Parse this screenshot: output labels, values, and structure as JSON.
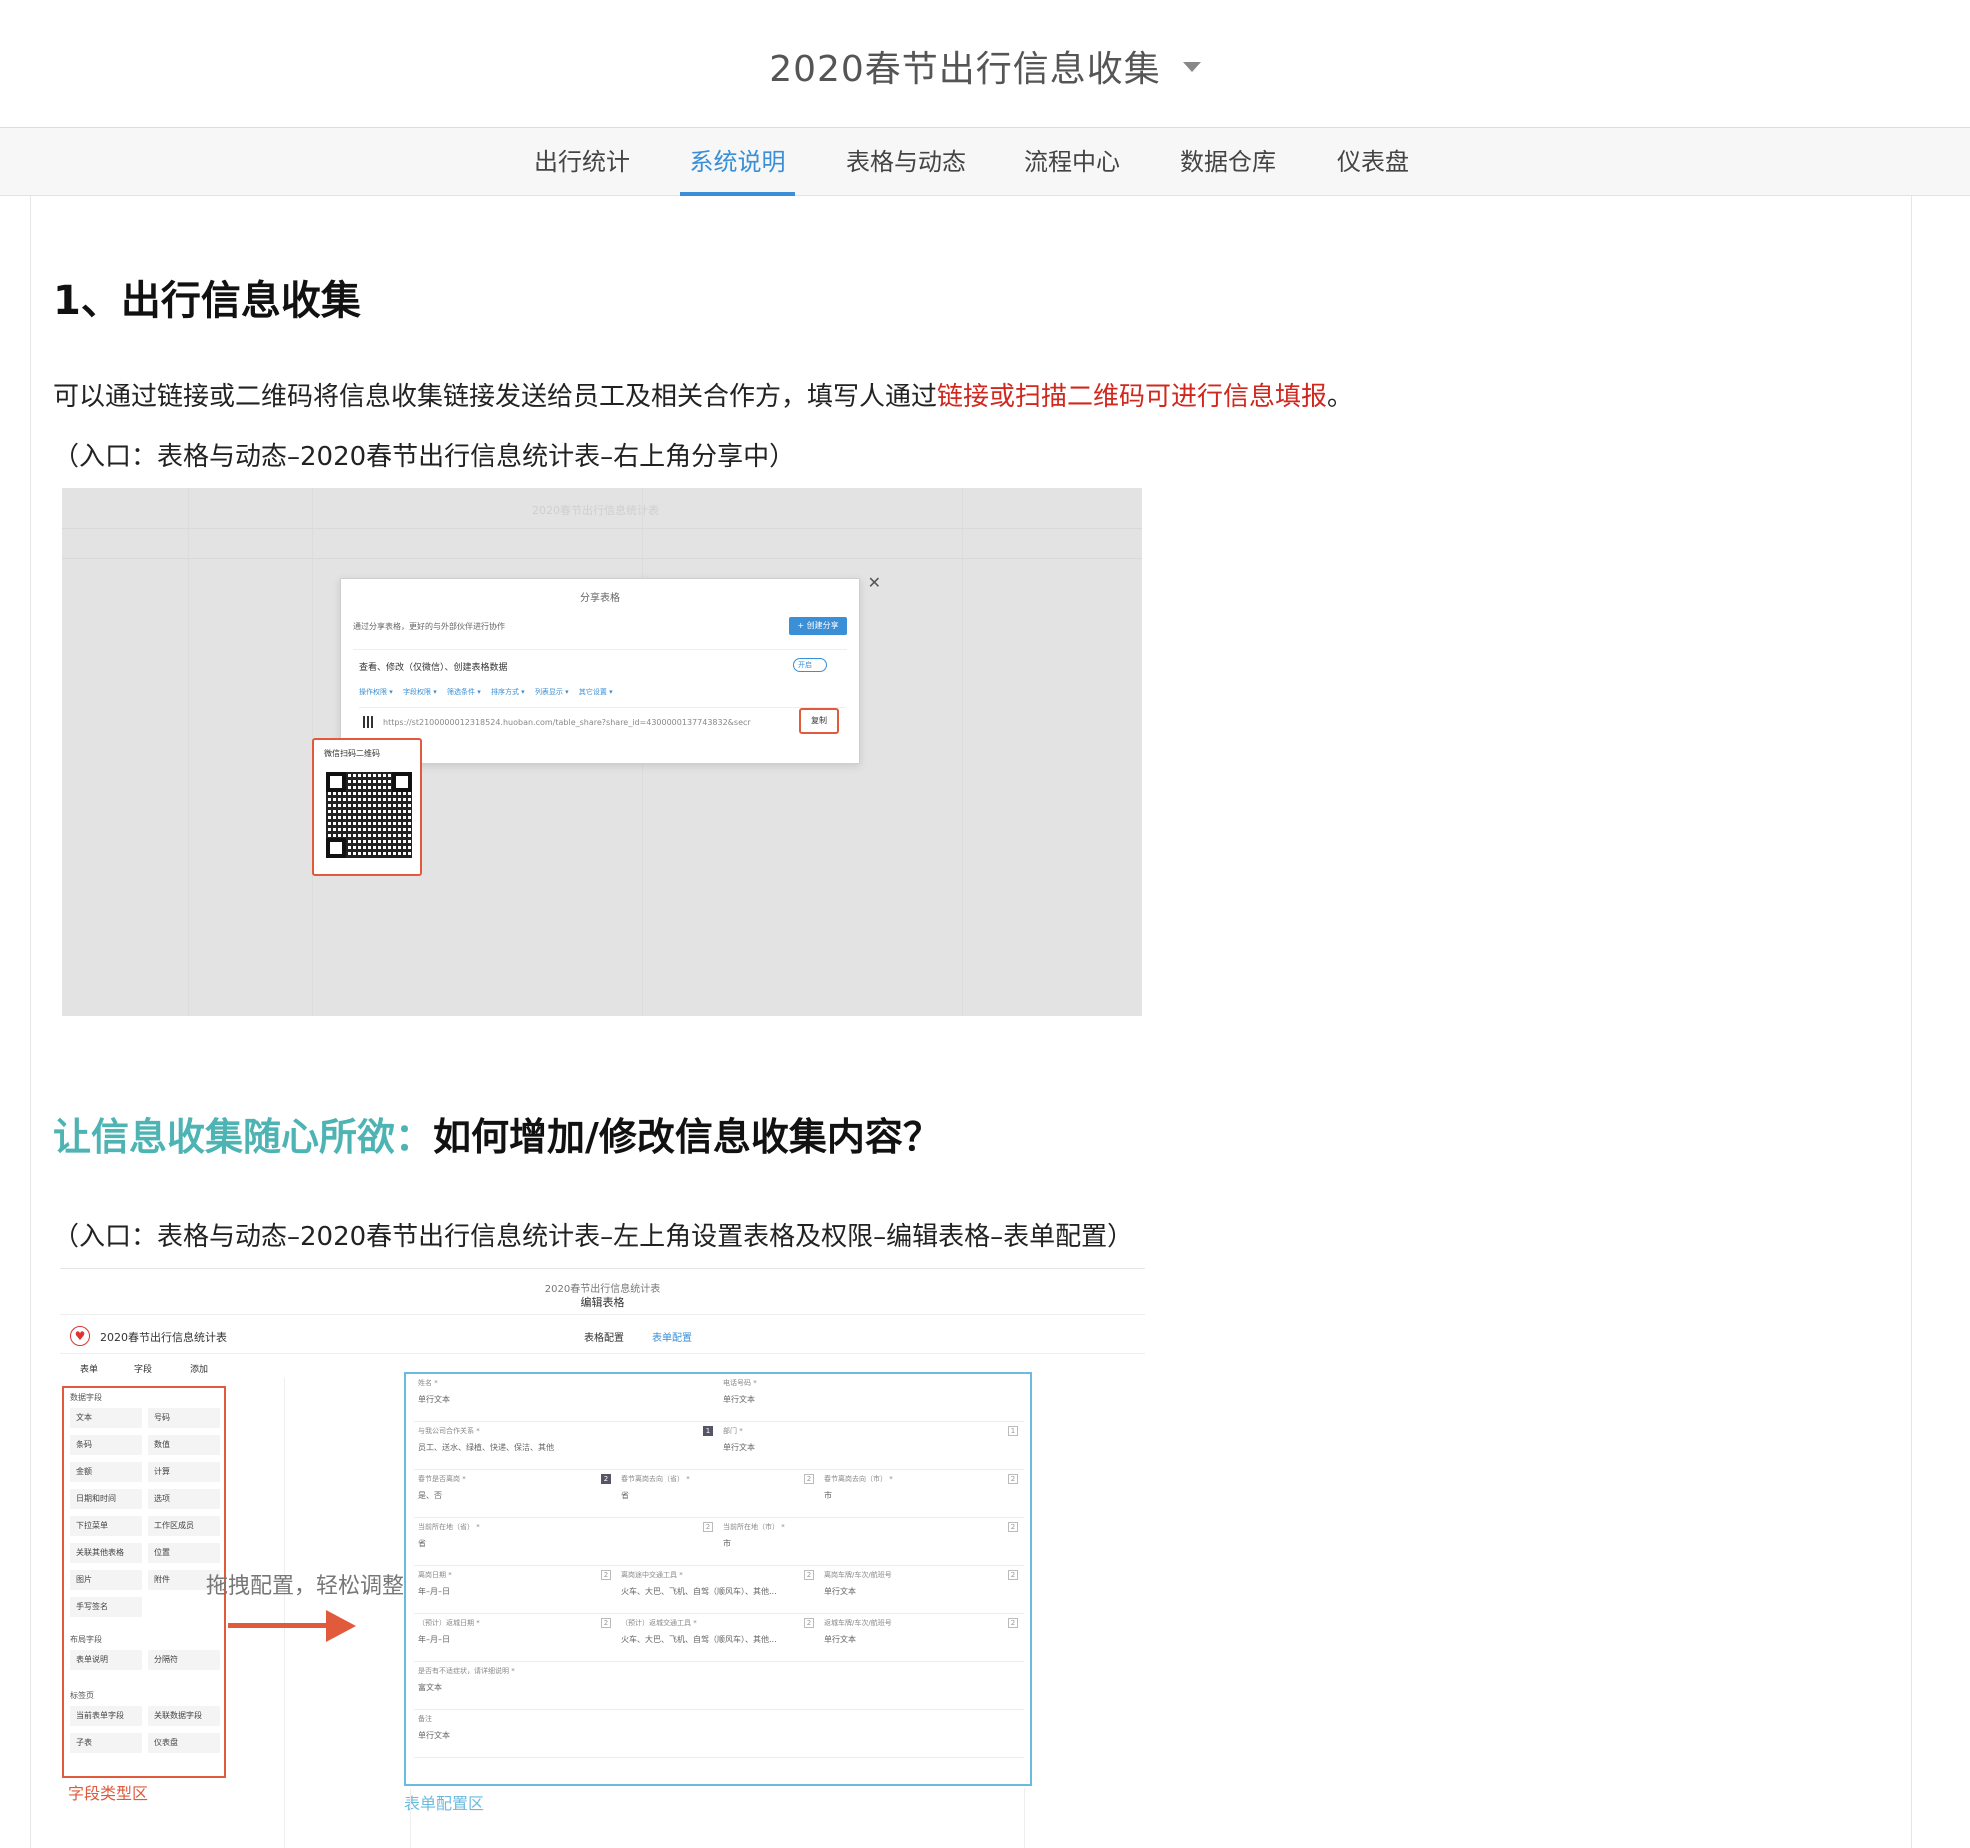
{
  "header": {
    "app_title": "2020春节出行信息收集"
  },
  "tabs": [
    {
      "label": "出行统计",
      "active": false
    },
    {
      "label": "系统说明",
      "active": true
    },
    {
      "label": "表格与动态",
      "active": false
    },
    {
      "label": "流程中心",
      "active": false
    },
    {
      "label": "数据仓库",
      "active": false
    },
    {
      "label": "仪表盘",
      "active": false
    }
  ],
  "content": {
    "heading1": "1、出行信息收集",
    "para_prefix": "可以通过链接或二维码将信息收集链接发送给员工及相关合作方，填写人通过",
    "para_highlight": "链接或扫描二维码可进行信息填报",
    "para_suffix": "。",
    "entry1": "（入口：表格与动态–2020春节出行信息统计表–右上角分享中）",
    "heading2_teal": "让信息收集随心所欲：",
    "heading2_dark": "如何增加/修改信息收集内容？",
    "entry2": "（入口：表格与动态–2020春节出行信息统计表–左上角设置表格及权限–编辑表格–表单配置）"
  },
  "screenshot1": {
    "window_title_faint": "2020春节出行信息统计表",
    "dialog_title": "分享表格",
    "dialog_desc": "通过分享表格，更好的与外部伙伴进行协作",
    "create_share": "+ 创建分享",
    "row_label": "查看、修改（仅微信）、创建表格数据",
    "toggle": "开启",
    "options": [
      "操作权限 ▾",
      "字段权限 ▾",
      "筛选条件 ▾",
      "排序方式 ▾",
      "列表显示 ▾",
      "其它设置 ▾"
    ],
    "url": "https://st2100000012318524.huoban.com/table_share?share_id=4300000137743832&secr",
    "copy": "复制",
    "qr_title": "微信扫码二维码"
  },
  "screenshot2": {
    "subtitle": "2020春节出行信息统计表",
    "subtitle2": "编辑表格",
    "table_name": "2020春节出行信息统计表",
    "top_tabs": [
      "表格配置",
      "表单配置"
    ],
    "left_tabs": [
      "表单",
      "字段",
      "添加"
    ],
    "group_data": "数据字段",
    "data_fields": [
      "文本",
      "号码",
      "条码",
      "数值",
      "金额",
      "计算",
      "日期和时间",
      "选项",
      "下拉菜单",
      "工作区成员",
      "关联其他表格",
      "位置",
      "图片",
      "附件",
      "手写签名"
    ],
    "group_layout": "布局字段",
    "layout_fields": [
      "表单说明",
      "分隔符"
    ],
    "group_tabs": "标签页",
    "tab_fields": [
      "当前表单字段",
      "关联数据字段",
      "子表",
      "仪表盘"
    ],
    "field_area_label": "字段类型区",
    "drag_hint": "拖拽配置，轻松调整",
    "form_area_label": "表单配置区",
    "form_rows": [
      [
        {
          "label": "姓名 *",
          "value": "单行文本"
        },
        {
          "label": "电话号码 *",
          "value": "单行文本"
        }
      ],
      [
        {
          "label": "与我公司合作关系 *",
          "value": "员工、送水、绿植、快递、保洁、其他",
          "n": "1"
        },
        {
          "label": "部门 *",
          "value": "单行文本",
          "n": "1"
        }
      ],
      [
        {
          "label": "春节是否离岗 *",
          "value": "是、否",
          "n": "2"
        },
        {
          "label": "春节离岗去向（省） *",
          "value": "省",
          "n": "2"
        },
        {
          "label": "春节离岗去向（市） *",
          "value": "市",
          "n": "2"
        }
      ],
      [
        {
          "label": "当前所在地（省） *",
          "value": "省",
          "n": "2"
        },
        {
          "label": "当前所在地（市） *",
          "value": "市",
          "n": "2"
        }
      ],
      [
        {
          "label": "离岗日期 *",
          "value": "年–月–日",
          "n": "2"
        },
        {
          "label": "离岗途中交通工具 *",
          "value": "火车、大巴、飞机、自驾（顺风车）、其他...",
          "n": "2"
        },
        {
          "label": "离岗车牌/车次/航班号",
          "value": "单行文本",
          "n": "2"
        }
      ],
      [
        {
          "label": "（预计）返城日期 *",
          "value": "年–月–日",
          "n": "2"
        },
        {
          "label": "（预计）返城交通工具 *",
          "value": "火车、大巴、飞机、自驾（顺风车）、其他...",
          "n": "2"
        },
        {
          "label": "返城车牌/车次/航班号",
          "value": "单行文本",
          "n": "2"
        }
      ],
      [
        {
          "label": "是否有不适症状，请详细说明 *",
          "value": "富文本"
        }
      ],
      [
        {
          "label": "备注",
          "value": "单行文本"
        }
      ]
    ]
  }
}
